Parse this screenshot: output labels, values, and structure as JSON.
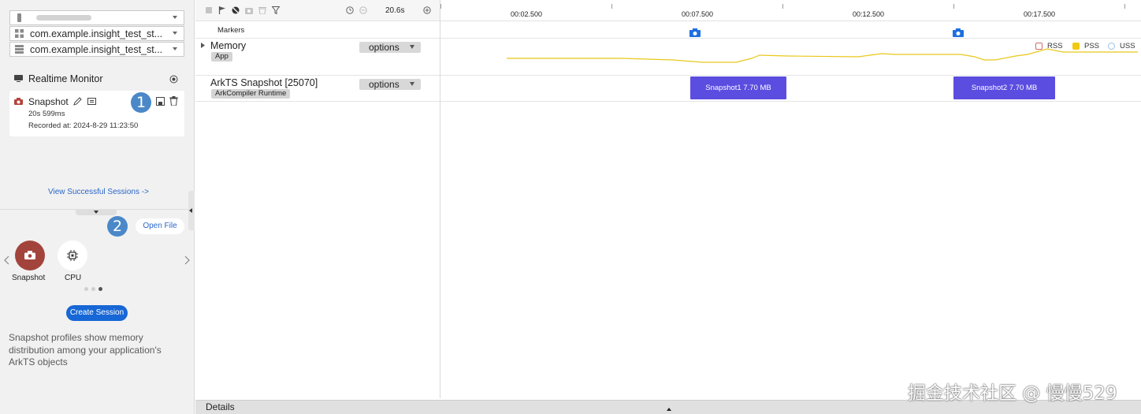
{
  "left": {
    "device_select": {
      "value": ""
    },
    "app_select": {
      "value": "com.example.insight_test_st..."
    },
    "process_select": {
      "value": "com.example.insight_test_st..."
    },
    "realtime_title": "Realtime Monitor",
    "session": {
      "name": "Snapshot",
      "duration": "20s 599ms",
      "recorded": "Recorded at: 2024-8-29 11:23:50",
      "badge": "1"
    },
    "view_sessions_link": "View Successful Sessions ->",
    "open_file": {
      "label": "Open File",
      "badge": "2"
    },
    "session_types": [
      {
        "label": "Snapshot",
        "selected": true,
        "color": "#a3443c"
      },
      {
        "label": "CPU",
        "selected": false,
        "color": "#ffffff"
      }
    ],
    "pager": {
      "pages": 3,
      "current": 3
    },
    "create_session": "Create Session",
    "description": "Snapshot profiles show memory distribution among your application's ArkTS objects"
  },
  "toolbar": {
    "duration": "20.6s"
  },
  "timeline": {
    "ticks": [
      "00:02.500",
      "00:07.500",
      "00:12.500",
      "00:17.500"
    ]
  },
  "rows": {
    "markers": {
      "label": "Markers"
    },
    "memory": {
      "label": "Memory",
      "tag": "App",
      "options": "options",
      "legend": [
        {
          "label": "RSS",
          "color": "#ffffff",
          "border": "#d06a6a"
        },
        {
          "label": "PSS",
          "color": "#f2c811",
          "border": "#f2c811"
        },
        {
          "label": "USS",
          "color": "#ffffff",
          "border": "#9bbfe0"
        }
      ],
      "line_color": "#e8c81a"
    },
    "snapshot": {
      "label": "ArkTS Snapshot [25070]",
      "tag": "ArkCompiler Runtime",
      "options": "options",
      "blocks": [
        {
          "label": "Snapshot1  7.70 MB"
        },
        {
          "label": "Snapshot2  7.70 MB"
        }
      ],
      "block_color": "#5b4de0"
    }
  },
  "details": {
    "label": "Details"
  },
  "watermark": "掘金技术社区 @ 慢慢529"
}
